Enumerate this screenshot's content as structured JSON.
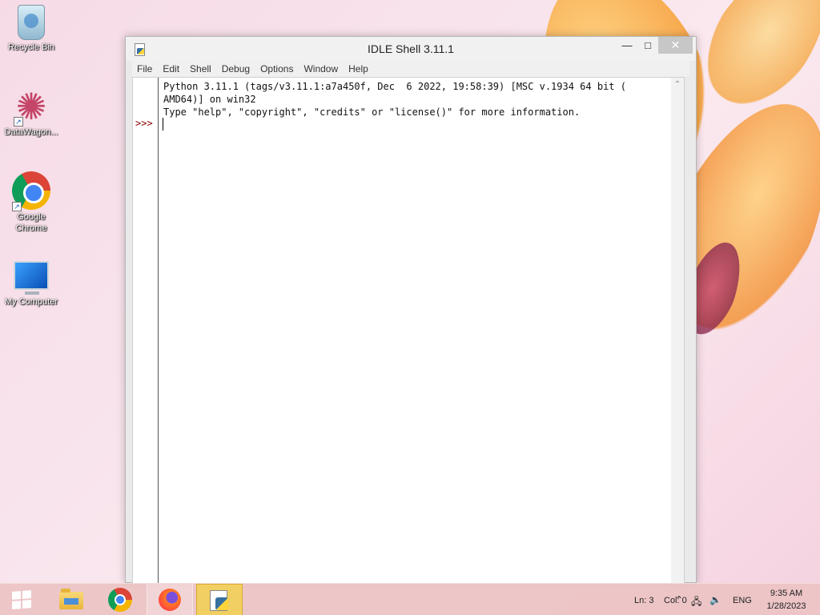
{
  "desktop": {
    "icons": [
      {
        "label": "Recycle Bin"
      },
      {
        "label": "DataWagon..."
      },
      {
        "label": "Google Chrome"
      },
      {
        "label": "My Computer"
      }
    ]
  },
  "window": {
    "title": "IDLE Shell 3.11.1",
    "controls": {
      "minimize": "—",
      "maximize": "□",
      "close": "✕"
    },
    "menu": [
      "File",
      "Edit",
      "Shell",
      "Debug",
      "Options",
      "Window",
      "Help"
    ],
    "shell": {
      "lines": [
        "Python 3.11.1 (tags/v3.11.1:a7a450f, Dec  6 2022, 19:58:39) [MSC v.1934 64 bit (",
        "AMD64)] on win32",
        "Type \"help\", \"copyright\", \"credits\" or \"license()\" for more information."
      ],
      "prompt": ">>>"
    }
  },
  "taskbar": {
    "apps": [
      "start",
      "file-explorer",
      "google-chrome",
      "firefox",
      "python-idle"
    ],
    "status_ln": "Ln: 3",
    "status_col": "Col: 0",
    "language": "ENG",
    "time": "9:35 AM",
    "date": "1/28/2023"
  }
}
